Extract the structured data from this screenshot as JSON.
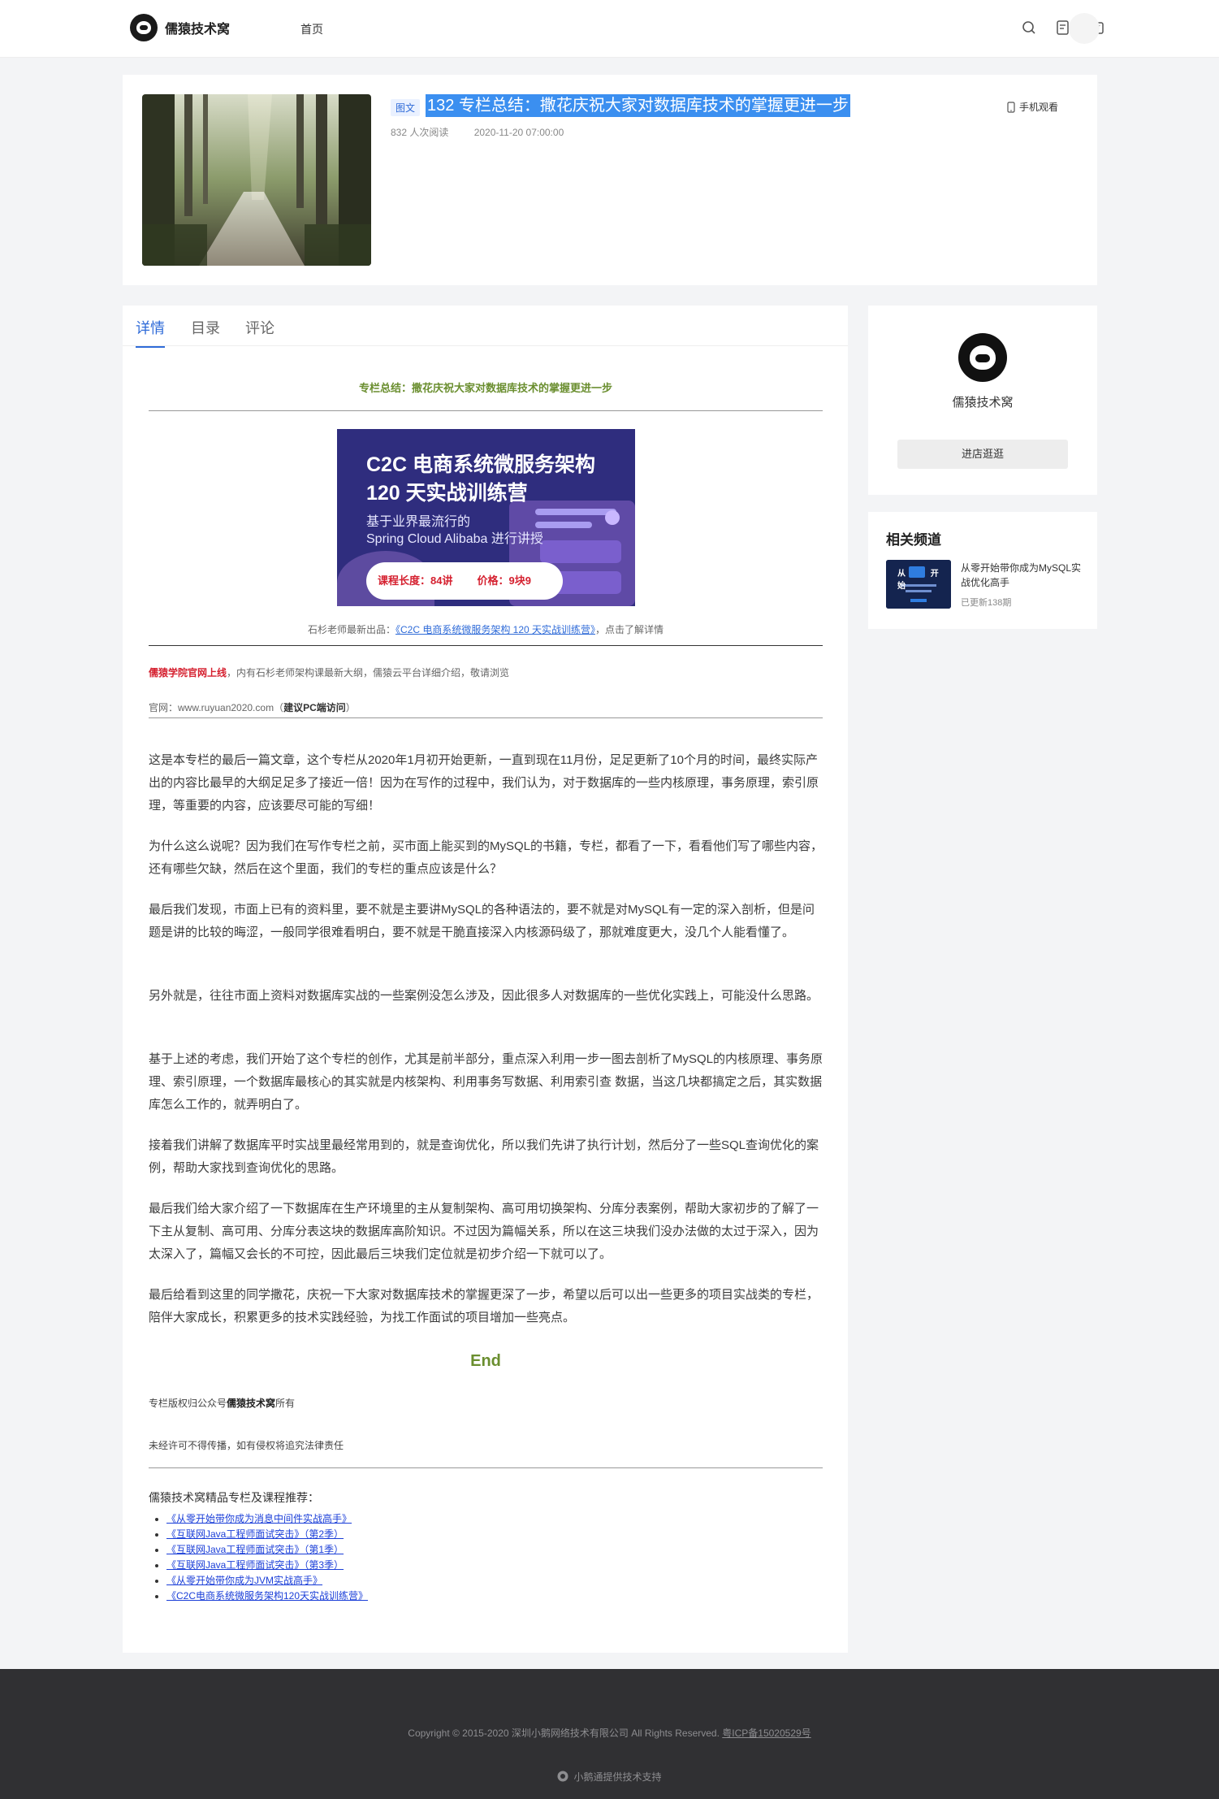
{
  "header": {
    "brand": "儒猿技术窝",
    "nav_home": "首页"
  },
  "hero": {
    "badge": "图文",
    "title": "132 专栏总结：撒花庆祝大家对数据库技术的掌握更进一步",
    "reads": "832 人次阅读",
    "date": "2020-11-20 07:00:00",
    "mobile_view": "手机观看"
  },
  "tabs": [
    "详情",
    "目录",
    "评论"
  ],
  "article": {
    "subtitle": "专栏总结：撒花庆祝大家对数据库技术的掌握更进一步",
    "banner": {
      "line1": "C2C 电商系统微服务架构",
      "line2": "120 天实战训练营",
      "sub1": "基于业界最流行的",
      "sub2": "Spring Cloud Alibaba 进行讲授",
      "length": "课程长度：84讲",
      "price": "价格：9块9"
    },
    "caption_prefix": "石杉老师最新出品：",
    "caption_link": "《C2C 电商系统微服务架构 120 天实战训练营》",
    "caption_suffix": "，点击了解详情",
    "note_red": "儒猿学院官网上线",
    "note_rest": "，内有石杉老师架构课最新大纲，儒猿云平台详细介绍，敬请浏览",
    "site_prefix": "官网：www.ruyuan2020.com（",
    "site_bold": "建议PC端访问",
    "site_suffix": "）",
    "paragraphs": [
      "这是本专栏的最后一篇文章，这个专栏从2020年1月初开始更新，一直到现在11月份，足足更新了10个月的时间，最终实际产出的内容比最早的大纲足足多了接近一倍！因为在写作的过程中，我们认为，对于数据库的一些内核原理，事务原理，索引原理，等重要的内容，应该要尽可能的写细！",
      "为什么这么说呢？因为我们在写作专栏之前，买市面上能买到的MySQL的书籍，专栏，都看了一下，看看他们写了哪些内容，还有哪些欠缺，然后在这个里面，我们的专栏的重点应该是什么？",
      "最后我们发现，市面上已有的资料里，要不就是主要讲MySQL的各种语法的，要不就是对MySQL有一定的深入剖析，但是问题是讲的比较的晦涩，一般同学很难看明白，要不就是干脆直接深入内核源码级了，那就难度更大，没几个人能看懂了。",
      "另外就是，往往市面上资料对数据库实战的一些案例没怎么涉及，因此很多人对数据库的一些优化实践上，可能没什么思路。",
      "基于上述的考虑，我们开始了这个专栏的创作，尤其是前半部分，重点深入利用一步一图去剖析了MySQL的内核原理、事务原理、索引原理，一个数据库最核心的其实就是内核架构、利用事务写数据、利用索引查 数据，当这几块都搞定之后，其实数据库怎么工作的，就弄明白了。",
      "接着我们讲解了数据库平时实战里最经常用到的，就是查询优化，所以我们先讲了执行计划，然后分了一些SQL查询优化的案例，帮助大家找到查询优化的思路。",
      "最后我们给大家介绍了一下数据库在生产环境里的主从复制架构、高可用切换架构、分库分表案例，帮助大家初步的了解了一下主从复制、高可用、分库分表这块的数据库高阶知识。不过因为篇幅关系，所以在这三块我们没办法做的太过于深入，因为太深入了，篇幅又会长的不可控，因此最后三块我们定位就是初步介绍一下就可以了。",
      "最后给看到这里的同学撒花，庆祝一下大家对数据库技术的掌握更深了一步，希望以后可以出一些更多的项目实战类的专栏，陪伴大家成长，积累更多的技术实践经验，为找工作面试的项目增加一些亮点。"
    ],
    "end": "End",
    "rights_prefix": "专栏版权归公众号",
    "rights_bold": "儒猿技术窝",
    "rights_suffix": "所有",
    "warn": "未经许可不得传播，如有侵权将追究法律责任",
    "rec_title": "儒猿技术窝精品专栏及课程推荐：",
    "rec_links": [
      "《从零开始带你成为消息中间件实战高手》",
      "《互联网Java工程师面试突击》（第2季）",
      "《互联网Java工程师面试突击》（第1季）",
      "《互联网Java工程师面试突击》（第3季）",
      "《从零开始带你成为JVM实战高手》",
      "《C2C电商系统微服务架构120天实战训练营》"
    ]
  },
  "sidebar": {
    "shop_name": "儒猿技术窝",
    "shop_button": "进店逛逛",
    "related_title": "相关频道",
    "channel_thumb_text": "从 开始",
    "channel_title": "从零开始带你成为MySQL实战优化高手",
    "channel_update": "已更新138期"
  },
  "footer": {
    "copyright": "Copyright © 2015-2020 深圳小鹅网络技术有限公司 All Rights Reserved.",
    "icp": "粤ICP备15020529号",
    "powered": "小鹅通提供技术支持"
  },
  "colors": {
    "accent": "#2f6bd8",
    "highlight": "#3b8ff0",
    "green_title": "#6a8e2f",
    "red": "#d5202f",
    "footer_bg": "#303033"
  }
}
